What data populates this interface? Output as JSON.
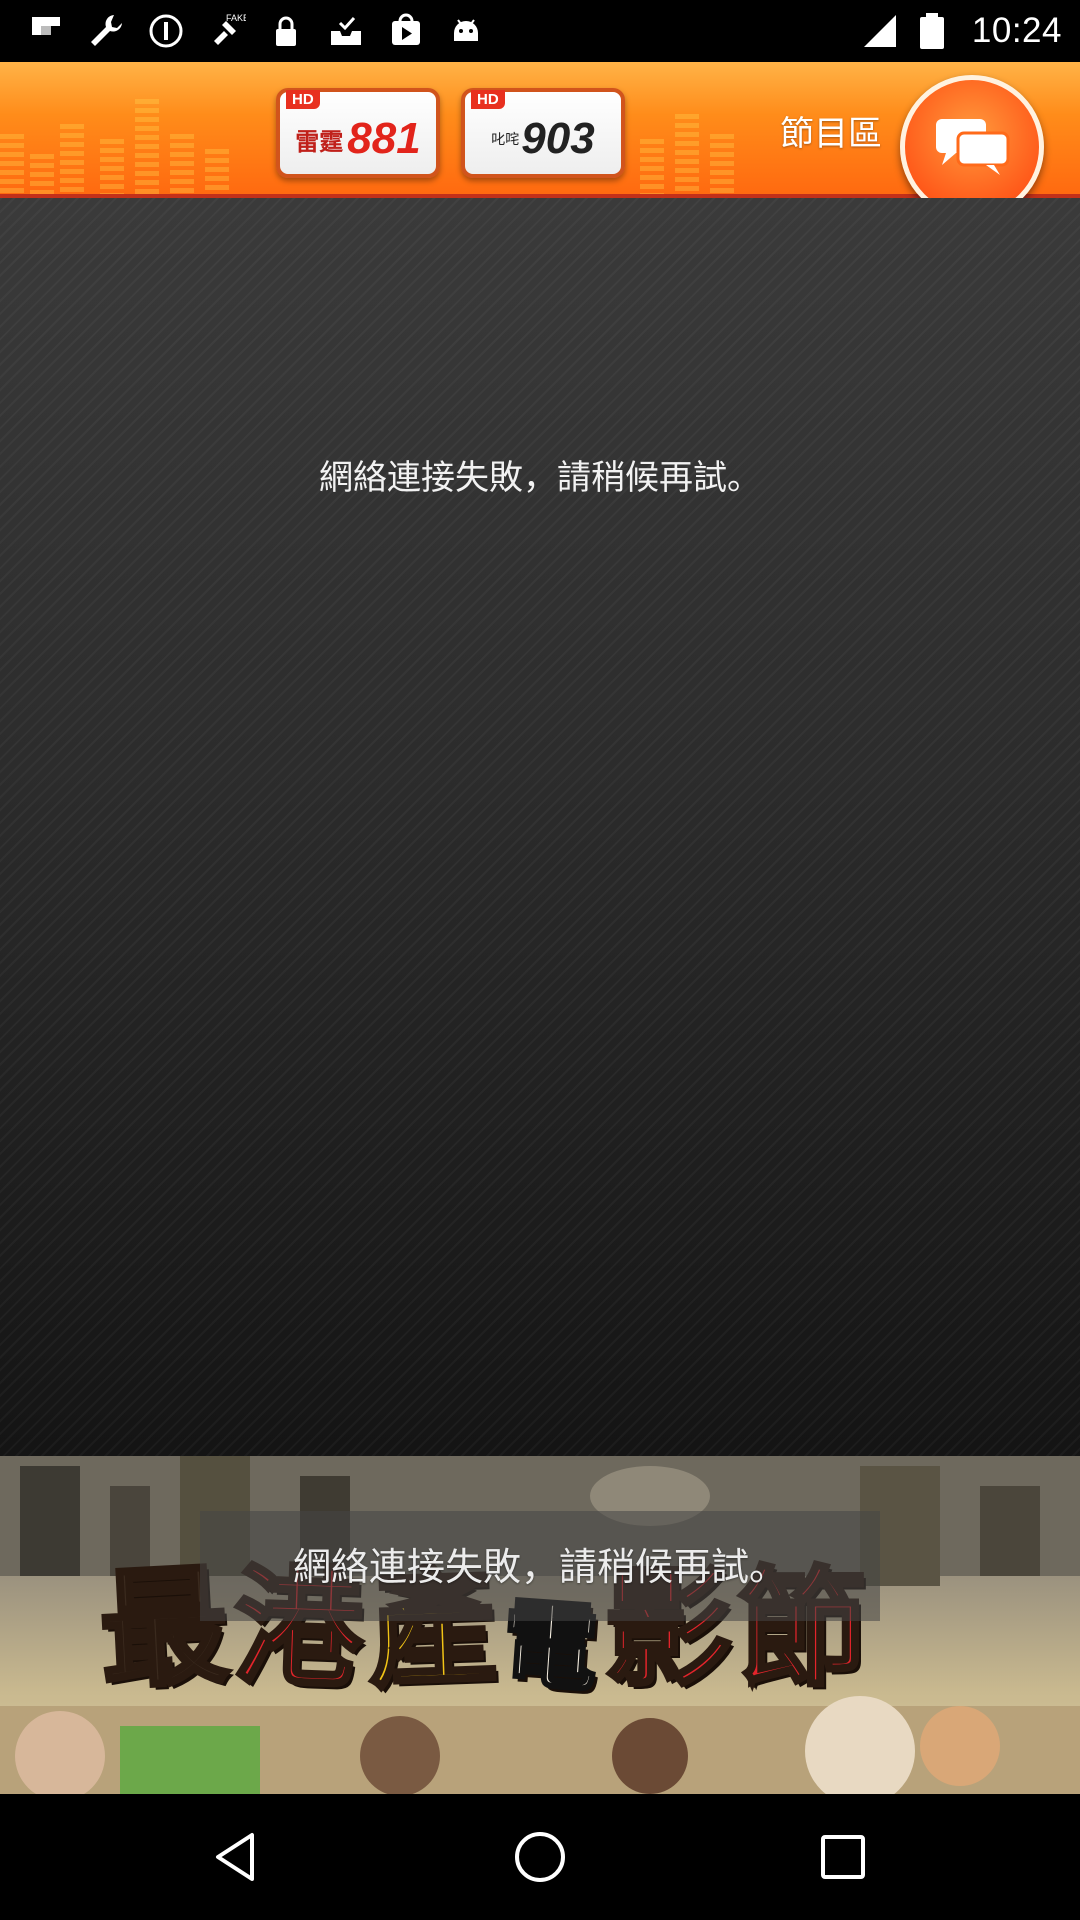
{
  "status_bar": {
    "time": "10:24",
    "left_icons": [
      "flipboard-icon",
      "wrench-icon",
      "info-icon",
      "fake-gps-icon",
      "lock-icon",
      "inbox-check-icon",
      "play-store-icon",
      "android-icon"
    ],
    "right_icons": [
      "signal-icon",
      "battery-icon"
    ]
  },
  "header": {
    "stations": [
      {
        "hd": "HD",
        "cn": "雷霆",
        "number": "881"
      },
      {
        "hd": "HD",
        "cn": "叱咤",
        "number": "903"
      }
    ],
    "program_label": "節目區",
    "chat_icon": "chat-bubbles-icon",
    "accent_color": "#ff7a1a"
  },
  "main": {
    "error_message": "網絡連接失敗，請稍候再試。"
  },
  "banner": {
    "title_chars": [
      "最",
      "港",
      "產",
      "電",
      "影",
      "節"
    ],
    "error_message": "網絡連接失敗，請稍候再試。"
  },
  "nav_bar": {
    "buttons": [
      "back-icon",
      "home-icon",
      "recent-apps-icon"
    ]
  }
}
